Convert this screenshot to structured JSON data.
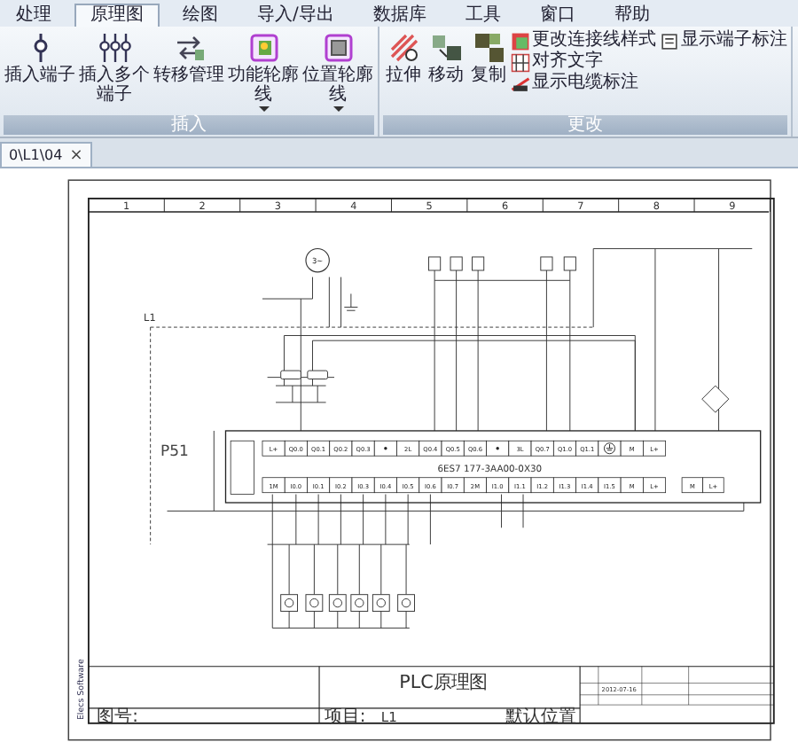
{
  "menu": [
    {
      "label": "处理",
      "selected": false
    },
    {
      "label": "原理图",
      "selected": true
    },
    {
      "label": "绘图",
      "selected": false
    },
    {
      "label": "导入/导出",
      "selected": false
    },
    {
      "label": "数据库",
      "selected": false
    },
    {
      "label": "工具",
      "selected": false
    },
    {
      "label": "窗口",
      "selected": false
    },
    {
      "label": "帮助",
      "selected": false
    }
  ],
  "ribbon": {
    "groups": [
      {
        "title": "插入",
        "large": [
          {
            "label": "插入端子",
            "kind": "terminal",
            "dropdown": false
          },
          {
            "label": "插入多个端子",
            "kind": "terminals",
            "dropdown": false
          },
          {
            "label": "转移管理",
            "kind": "transfer",
            "dropdown": false
          },
          {
            "label": "功能轮廓线",
            "kind": "function-outline",
            "dropdown": true
          },
          {
            "label": "位置轮廓线",
            "kind": "location-outline",
            "dropdown": true
          }
        ]
      },
      {
        "title": "更改",
        "large": [
          {
            "label": "拉伸",
            "kind": "stretch",
            "dropdown": false
          },
          {
            "label": "移动",
            "kind": "move",
            "dropdown": false
          },
          {
            "label": "复制",
            "kind": "copy",
            "dropdown": false
          }
        ],
        "small": [
          {
            "label": "更改连接线样式",
            "kind": "line-style"
          },
          {
            "label": "对齐文字",
            "kind": "align-text"
          },
          {
            "label": "显示电缆标注",
            "kind": "cable"
          },
          {
            "label": "显示端子标注",
            "kind": "terminal-label"
          }
        ]
      }
    ]
  },
  "document_tab": {
    "label": "0\\L1\\04",
    "close": "×"
  },
  "drawing": {
    "column_numbers": [
      "1",
      "2",
      "3",
      "4",
      "5",
      "6",
      "7",
      "8",
      "9"
    ],
    "wire_label": "L1",
    "motor_label": "3~",
    "plc": {
      "tag": "P51",
      "model": "6ES7 177-3AA00-0X30",
      "outputs": [
        {
          "kind": "text",
          "label": "L+"
        },
        {
          "kind": "text",
          "label": "Q0.0"
        },
        {
          "kind": "text",
          "label": "Q0.1"
        },
        {
          "kind": "text",
          "label": "Q0.2"
        },
        {
          "kind": "text",
          "label": "Q0.3"
        },
        {
          "kind": "dot"
        },
        {
          "kind": "text",
          "label": "2L"
        },
        {
          "kind": "text",
          "label": "Q0.4"
        },
        {
          "kind": "text",
          "label": "Q0.5"
        },
        {
          "kind": "text",
          "label": "Q0.6"
        },
        {
          "kind": "dot"
        },
        {
          "kind": "text",
          "label": "3L"
        },
        {
          "kind": "text",
          "label": "Q0.7"
        },
        {
          "kind": "text",
          "label": "Q1.0"
        },
        {
          "kind": "text",
          "label": "Q1.1"
        },
        {
          "kind": "ground"
        },
        {
          "kind": "text",
          "label": "M"
        },
        {
          "kind": "text",
          "label": "L+"
        }
      ],
      "inputs": [
        "1M",
        "I0.0",
        "I0.1",
        "I0.2",
        "I0.3",
        "I0.4",
        "I0.5",
        "I0.6",
        "I0.7",
        "2M",
        "I1.0",
        "I1.1",
        "I1.2",
        "I1.3",
        "I1.4",
        "I1.5",
        "M",
        "L+"
      ],
      "power": [
        "M",
        "L+"
      ]
    },
    "title_block": {
      "title": "PLC原理图",
      "number_label": "图号:",
      "project_label": "项目:",
      "project": "L1",
      "location": "默认位置",
      "date": "2012-07-16"
    },
    "logo": "Elecs Software"
  }
}
